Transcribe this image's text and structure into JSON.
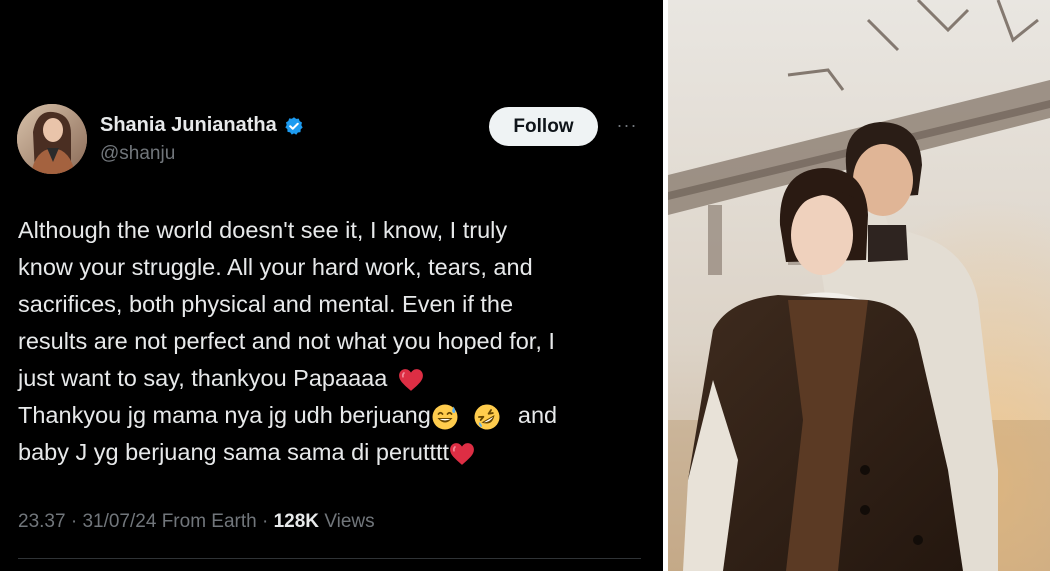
{
  "tweet": {
    "display_name": "Shania Junianatha",
    "handle": "@shanju",
    "follow_label": "Follow",
    "more_label": "···",
    "lines": [
      "Although the world doesn't see it, I know, I truly",
      "know your struggle. All your hard work, tears, and",
      "sacrifices, both physical and mental. Even if the",
      "results are not perfect and not what you hoped for, I",
      "just want to say, thankyou Papaaaa",
      "Thankyou jg mama nya jg udh berjuang",
      "and",
      "baby J yg berjuang sama sama di perutttt"
    ],
    "time": "23.37",
    "sep1": "·",
    "date": "31/07/24",
    "source": "From Earth",
    "sep2": "·",
    "views_count": "128K",
    "views_label": "Views"
  },
  "colors": {
    "background": "#000000",
    "text": "#e7e9ea",
    "muted": "#71767b",
    "verified": "#1d9bf0",
    "heart": "#e0245e"
  },
  "icons": [
    "verified-badge-icon",
    "red-heart-icon",
    "grinning-sweat-emoji-icon",
    "rolling-laughing-emoji-icon",
    "more-options-icon"
  ]
}
